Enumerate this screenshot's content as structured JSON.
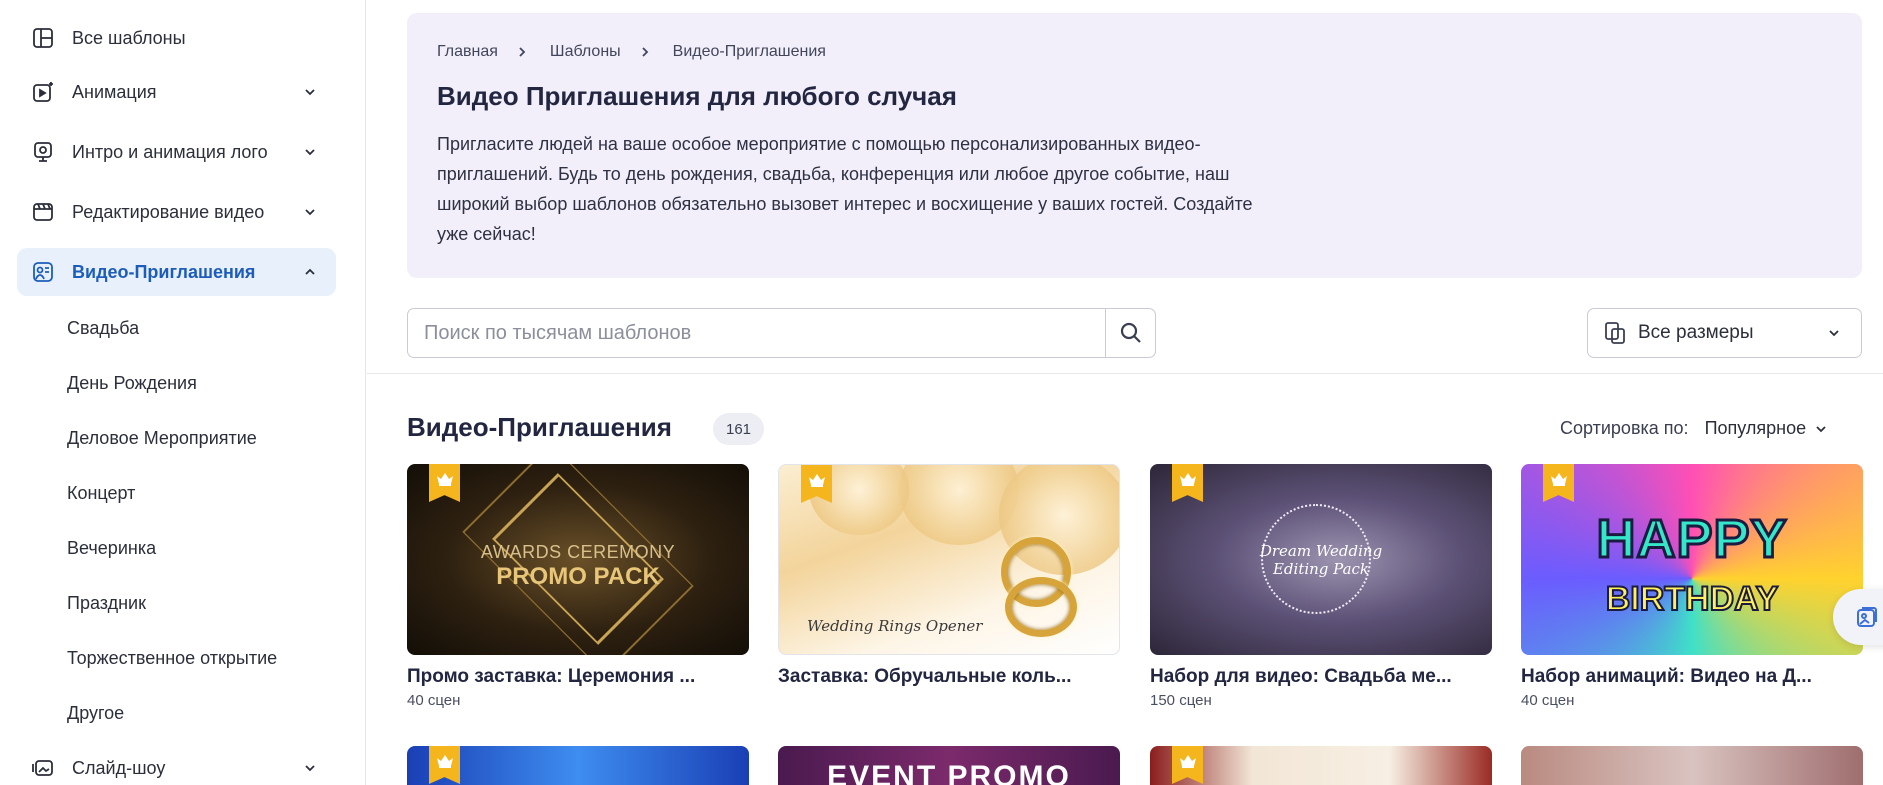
{
  "sidebar": {
    "items": [
      {
        "label": "Все шаблоны",
        "icon": "grid-icon"
      },
      {
        "label": "Анимация",
        "icon": "animation-icon"
      },
      {
        "label": "Интро и анимация лого",
        "icon": "logo-intro-icon"
      },
      {
        "label": "Редактирование видео",
        "icon": "video-edit-icon"
      },
      {
        "label": "Видео-Приглашения",
        "icon": "invitation-icon",
        "active": true
      },
      {
        "label": "Слайд-шоу",
        "icon": "slideshow-icon"
      }
    ],
    "sub_items": [
      "Свадьба",
      "День Рождения",
      "Деловое Мероприятие",
      "Концерт",
      "Вечеринка",
      "Праздник",
      "Торжественное открытие",
      "Другое"
    ]
  },
  "breadcrumb": [
    "Главная",
    "Шаблоны",
    "Видео-Приглашения"
  ],
  "hero": {
    "title": "Видео Приглашения для любого случая",
    "description": "Пригласите людей на ваше особое мероприятие с помощью персонализированных видео-приглашений. Будь то день рождения, свадьба, конференция или любое другое событие, наш широкий выбор шаблонов обязательно вызовет интерес и восхищение у ваших гостей. Создайте уже сейчас!"
  },
  "search": {
    "placeholder": "Поиск по тысячам шаблонов",
    "value": ""
  },
  "size_filter": {
    "label": "Все размеры"
  },
  "section": {
    "title": "Видео-Приглашения",
    "count": "161"
  },
  "sort": {
    "label": "Сортировка по:",
    "value": "Популярное"
  },
  "cards": [
    {
      "title": "Промо заставка: Церемония ...",
      "scenes": "40 сцен",
      "thumb_line1": "AWARDS CEREMONY",
      "thumb_line2": "PROMO PACK",
      "premium": true
    },
    {
      "title": "Заставка: Обручальные коль...",
      "scenes": "",
      "thumb_line1": "Wedding Rings Opener",
      "premium": true
    },
    {
      "title": "Набор для видео: Свадьба ме...",
      "scenes": "150 сцен",
      "thumb_line1": "Dream Wedding",
      "thumb_line2": "Editing Pack",
      "premium": true
    },
    {
      "title": "Набор анимаций: Видео на Д...",
      "scenes": "40 сцен",
      "thumb_line1": "HAPPY",
      "thumb_line2": "BIRTHDAY",
      "premium": true
    }
  ],
  "row2_cards": [
    {
      "premium": true
    },
    {
      "thumb_text": "EVENT PROMO",
      "premium": false
    },
    {
      "premium": true
    },
    {
      "premium": false
    }
  ],
  "colors": {
    "accent": "#1c5dbb",
    "active_bg": "#e8f0fc",
    "hero_bg": "#f2effa",
    "crown": "#f5b51c"
  }
}
